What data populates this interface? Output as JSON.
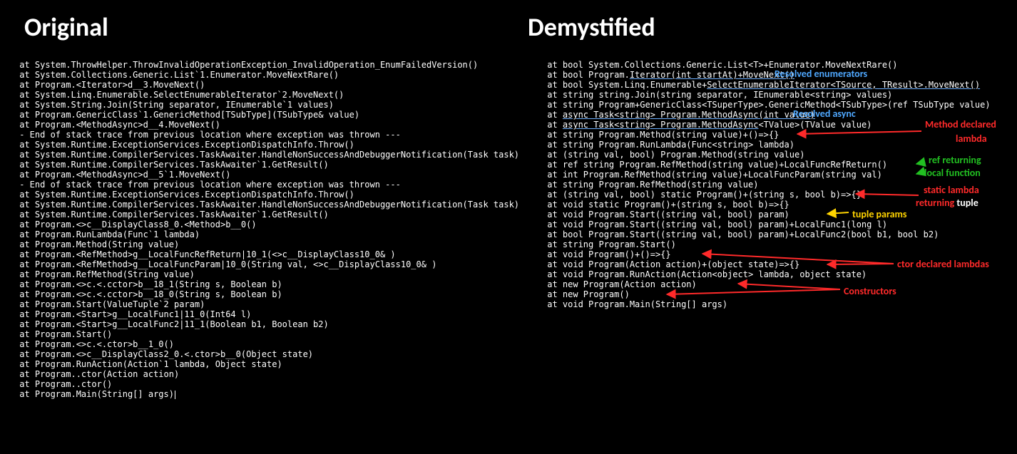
{
  "headers": {
    "left": "Original",
    "right": "Demystified"
  },
  "annotations": {
    "resolved_enumerators": "Resolved enumerators",
    "resolved_async": "Resolved async",
    "method_declared": "Method declared",
    "lambda": "lambda",
    "ref_returning": "ref returning",
    "local_function": "local function",
    "static_lambda": "static lambda",
    "returning": "returning",
    "tuple": "tuple",
    "tuple_params": "tuple params",
    "ctor_declared_lambdas": "ctor declared lambdas",
    "constructors": "Constructors"
  },
  "original_lines": [
    "at System.ThrowHelper.ThrowInvalidOperationException_InvalidOperation_EnumFailedVersion()",
    "at System.Collections.Generic.List`1.Enumerator.MoveNextRare()",
    "at Program.<Iterator>d__3.MoveNext()",
    "at System.Linq.Enumerable.SelectEnumerableIterator`2.MoveNext()",
    "at System.String.Join(String separator, IEnumerable`1 values)",
    "at Program.GenericClass`1.GenericMethod[TSubType](TSubType& value)",
    "at Program.<MethodAsync>d__4.MoveNext()",
    "- End of stack trace from previous location where exception was thrown ---",
    "at System.Runtime.ExceptionServices.ExceptionDispatchInfo.Throw()",
    "at System.Runtime.CompilerServices.TaskAwaiter.HandleNonSuccessAndDebuggerNotification(Task task)",
    "at System.Runtime.CompilerServices.TaskAwaiter`1.GetResult()",
    "at Program.<MethodAsync>d__5`1.MoveNext()",
    "- End of stack trace from previous location where exception was thrown ---",
    "at System.Runtime.ExceptionServices.ExceptionDispatchInfo.Throw()",
    "at System.Runtime.CompilerServices.TaskAwaiter.HandleNonSuccessAndDebuggerNotification(Task task)",
    "at System.Runtime.CompilerServices.TaskAwaiter`1.GetResult()",
    "at Program.<>c__DisplayClass8_0.<Method>b__0()",
    "at Program.RunLambda(Func`1 lambda)",
    "at Program.Method(String value)",
    "at Program.<RefMethod>g__LocalFuncRefReturn|10_1(<>c__DisplayClass10_0& )",
    "at Program.<RefMethod>g__LocalFuncParam|10_0(String val, <>c__DisplayClass10_0& )",
    "at Program.RefMethod(String value)",
    "at Program.<>c.<.cctor>b__18_1(String s, Boolean b)",
    "at Program.<>c.<.cctor>b__18_0(String s, Boolean b)",
    "at Program.Start(ValueTuple`2 param)",
    "at Program.<Start>g__LocalFunc1|11_0(Int64 l)",
    "at Program.<Start>g__LocalFunc2|11_1(Boolean b1, Boolean b2)",
    "at Program.Start()",
    "at Program.<>c.<.ctor>b__1_0()",
    "at Program.<>c__DisplayClass2_0.<.ctor>b__0(Object state)",
    "at Program.RunAction(Action`1 lambda, Object state)",
    "at Program..ctor(Action action)",
    "at Program..ctor()",
    "at Program.Main(String[] args)"
  ],
  "demystified": {
    "l0": "at bool System.Collections.Generic.List<T>+Enumerator.MoveNextRare()",
    "l1_pre": "at bool Program.",
    "l1_u": "Iterator(int startAt)+MoveNext()",
    "l2_pre": "at bool System.Linq.Enumerable+",
    "l2_u": "SelectEnumerableIterator<TSource, TResult>.MoveNext()",
    "l3": "at string string.Join(string separator, IEnumerable<string> values)",
    "l4": "at string Program+GenericClass<TSuperType>.GenericMethod<TSubType>(ref TSubType value)",
    "l5_pre": "at ",
    "l5_u": "async Task<string> Program.MethodAsync(int value)",
    "l6_pre": "at ",
    "l6_u": "async Task<string> Program.MethodAsync",
    "l6_post": "<TValue>(TValue value)",
    "l7": "at string Program.Method(string value)+()=>{}",
    "l8": "at string Program.RunLambda(Func<string> lambda)",
    "l9": "at (string val, bool) Program.Method(string value)",
    "l10": "at ref string Program.RefMethod(string value)+LocalFuncRefReturn()",
    "l11": "at int Program.RefMethod(string value)+LocalFuncParam(string val)",
    "l12": "at string Program.RefMethod(string value)",
    "l13": "at (string val, bool) static Program()+(string s, bool b)=>{}",
    "l14": "at void static Program()+(string s, bool b)=>{}",
    "l15": "at void Program.Start((string val, bool) param)",
    "l16": "at void Program.Start((string val, bool) param)+LocalFunc1(long l)",
    "l17": "at bool Program.Start((string val, bool) param)+LocalFunc2(bool b1, bool b2)",
    "l18": "at string Program.Start()",
    "l19": "at void Program()+()=>{}",
    "l20": "at void Program(Action action)+(object state)=>{}",
    "l21": "at void Program.RunAction(Action<object> lambda, object state)",
    "l22": "at new Program(Action action)",
    "l23": "at new Program()",
    "l24": "at void Program.Main(String[] args)"
  }
}
